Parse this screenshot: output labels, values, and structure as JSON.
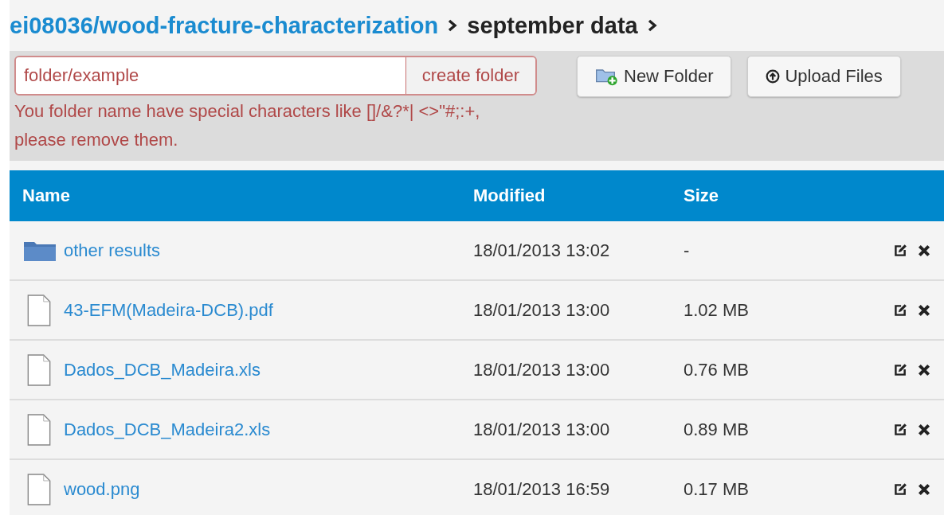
{
  "breadcrumb": [
    {
      "text": "ei08036/wood-fracture-characterization",
      "kind": "link"
    },
    {
      "text": "september data",
      "kind": "current"
    }
  ],
  "folder_form": {
    "value": "folder/example",
    "button": "create folder",
    "error": "You folder name have special characters like []/&?*| <>\"#;:+, please remove them."
  },
  "toolbar": [
    "New Folder",
    "Upload Files"
  ],
  "table": {
    "columns": [
      "Name",
      "Modified",
      "Size"
    ],
    "rows": [
      {
        "kind": "folder",
        "name": "other results",
        "modified": "18/01/2013 13:02",
        "size": "-"
      },
      {
        "kind": "file",
        "name": "43-EFM(Madeira-DCB).pdf",
        "modified": "18/01/2013 13:00",
        "size": "1.02 MB"
      },
      {
        "kind": "file",
        "name": "Dados_DCB_Madeira.xls",
        "modified": "18/01/2013 13:00",
        "size": "0.76 MB"
      },
      {
        "kind": "file",
        "name": "Dados_DCB_Madeira2.xls",
        "modified": "18/01/2013 13:00",
        "size": "0.89 MB"
      },
      {
        "kind": "file",
        "name": "wood.png",
        "modified": "18/01/2013 16:59",
        "size": "0.17 MB"
      }
    ]
  }
}
